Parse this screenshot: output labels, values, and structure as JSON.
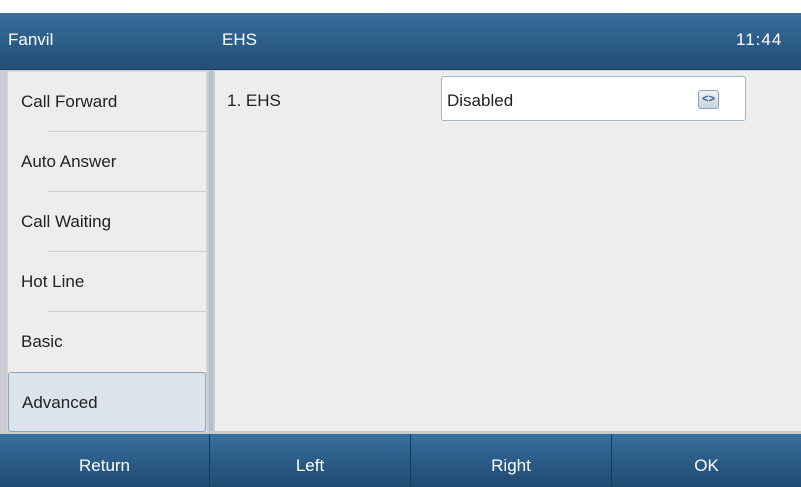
{
  "header": {
    "brand": "Fanvil",
    "title": "EHS",
    "time": "11:44"
  },
  "sidebar": {
    "items": [
      {
        "label": "Call Forward"
      },
      {
        "label": "Auto Answer"
      },
      {
        "label": "Call Waiting"
      },
      {
        "label": "Hot Line"
      },
      {
        "label": "Basic"
      },
      {
        "label": "Advanced",
        "active": true
      }
    ]
  },
  "main": {
    "row": {
      "label": "1. EHS",
      "value": "Disabled",
      "switch_icon": "left-right-arrows-icon"
    }
  },
  "softkeys": [
    {
      "label": "Return"
    },
    {
      "label": "Left"
    },
    {
      "label": "Right"
    },
    {
      "label": "OK"
    }
  ],
  "colors": {
    "header": "#2a5a86",
    "panel": "#ededed",
    "accent_border": "#9fb6cc"
  }
}
